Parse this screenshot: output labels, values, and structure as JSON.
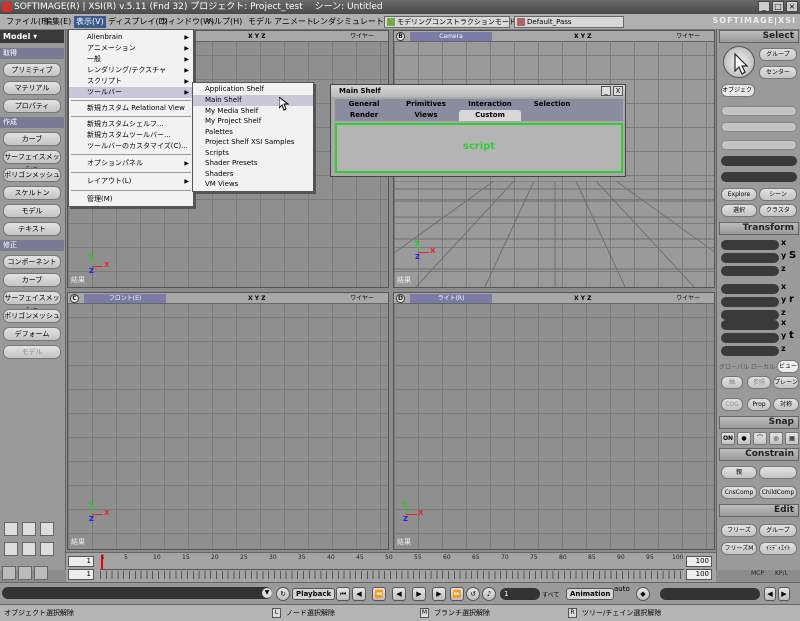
{
  "window": {
    "title": "SOFTIMAGE(R) | XSI(R) v.5.11 (Fnd 32) プロジェクト: Project_test　 シーン: Untitled",
    "brand": "SOFTIMAGE|XSI"
  },
  "menubar": {
    "items": [
      "ファイル(F)",
      "編集(E)",
      "表示(V)",
      "ディスプレイ(D)",
      "ウィンドウ(W)",
      "ヘルプ(H)",
      "モデル",
      "アニメート",
      "レンダ",
      "シミュレート"
    ],
    "mode_combo": "モデリングコンストラクションモード",
    "pass_combo": "Default_Pass"
  },
  "left_toolbar": {
    "model_label": "Model",
    "sections": [
      {
        "header": "取得",
        "buttons": [
          "プリミティブ",
          "マテリアル",
          "プロパティ"
        ]
      },
      {
        "header": "作成",
        "buttons": [
          "カーブ",
          "サーフェイスメッシュ",
          "ポリゴンメッシュ",
          "スケルトン",
          "モデル",
          "テキスト"
        ]
      },
      {
        "header": "修正",
        "buttons": [
          "コンポーネント",
          "カーブ",
          "サーフェイスメッシュ",
          "ポリゴンメッシュ",
          "デフォーム",
          "モデル"
        ]
      }
    ]
  },
  "view_menu": {
    "items": [
      {
        "label": "Alienbrain",
        "arrow": true
      },
      {
        "label": "アニメーション",
        "arrow": true
      },
      {
        "label": "一般",
        "arrow": true
      },
      {
        "label": "レンダリング/テクスチャ",
        "arrow": true
      },
      {
        "label": "スクリプト",
        "arrow": true
      },
      {
        "label": "ツールバー",
        "arrow": true
      },
      {
        "label": "新規カスタム Relational View",
        "arrow": false
      },
      {
        "label": "新規カスタムシェルフ...",
        "arrow": false
      },
      {
        "label": "新規カスタムツールバー...",
        "arrow": false
      },
      {
        "label": "ツールバーのカスタマイズ(C)...",
        "arrow": false
      },
      {
        "label": "オプションパネル",
        "arrow": true
      },
      {
        "label": "レイアウト(L)",
        "arrow": true
      },
      {
        "label": "管理(M)",
        "arrow": false
      }
    ]
  },
  "toolbar_submenu": {
    "items": [
      "Application Shelf",
      "Main Shelf",
      "My Media Shelf",
      "My Project Shelf",
      "Palettes",
      "Project Shelf XSI Samples",
      "Scripts",
      "Shader Presets",
      "Shaders",
      "VM Views"
    ]
  },
  "main_shelf": {
    "title": "Main Shelf",
    "tabs_row1": [
      "General",
      "Primitives",
      "Interaction",
      "Selection"
    ],
    "tabs_row2": [
      "Render",
      "Views",
      "Custom"
    ],
    "active_tab": "Custom",
    "content_text": "script",
    "min_btn": "_",
    "close_btn": "X"
  },
  "viewports": [
    {
      "letter": "A",
      "camera": "",
      "xyz": "X Y Z",
      "wire": "ワイヤー",
      "status": "結果"
    },
    {
      "letter": "B",
      "camera": "Camera",
      "xyz": "X Y Z",
      "wire": "ワイヤー",
      "status": "結果"
    },
    {
      "letter": "C",
      "camera": "フロント(E)",
      "xyz": "X Y Z",
      "wire": "ワイヤー",
      "status": "結果"
    },
    {
      "letter": "D",
      "camera": "ライト(R)",
      "xyz": "X Y Z",
      "wire": "ワイヤー",
      "status": "結果"
    }
  ],
  "axis": {
    "x": "X",
    "y": "Y",
    "z": "Z"
  },
  "right_panel": {
    "select_header": "Select",
    "group_btn": "グループ",
    "center_btn": "センター",
    "object_btn": "オブジェクト",
    "explore_btn": "Explore",
    "scene_btn": "シーン",
    "select_btn": "選択",
    "class_btn": "クラスタ",
    "transform_header": "Transform",
    "s": "S",
    "r": "r",
    "t": "t",
    "x": "x",
    "y": "y",
    "z": "z",
    "global": "グローバル",
    "local": "ローカル",
    "view": "ビュー",
    "axis_btn": "軸",
    "ref_btn": "参照",
    "plane_btn": "プレーン",
    "cog_btn": "COG",
    "prop_btn": "Prop",
    "sym_btn": "対称",
    "snap_header": "Snap",
    "on_btn": "ON",
    "constrain_header": "Constrain",
    "parent_btn": "親",
    "cnscomp_btn": "CnsComp",
    "childcomp_btn": "ChildComp",
    "edit_header": "Edit",
    "freeze_btn": "フリーズ",
    "group2_btn": "グループ",
    "freezem_btn": "フリーズM",
    "immed_btn": "ｲﾐﾃﾞｨｴｲﾄ",
    "mcp": "MCP",
    "kpl": "KP/L"
  },
  "timeline": {
    "start": "1",
    "current": "1",
    "end": "100",
    "end2": "100",
    "ticks": [
      "1",
      "5",
      "10",
      "15",
      "20",
      "25",
      "30",
      "35",
      "40",
      "45",
      "50",
      "55",
      "60",
      "65",
      "70",
      "75",
      "80",
      "85",
      "90",
      "95",
      "100"
    ]
  },
  "playbar": {
    "playback_label": "Playback",
    "frame_value": "1",
    "all_label": "すべて",
    "animation_label": "Animation",
    "auto_label": "auto"
  },
  "statusbar": {
    "left_text": "オブジェクト選択解除",
    "l_key": "L",
    "l_text": "ノード選択解除",
    "m_key": "M",
    "m_text": "ブランチ選択解除",
    "r_key": "R",
    "r_text": "ツリー/チェイン選択解除"
  },
  "colors": {
    "script_green": "#33cc33",
    "menu_highlight": "#3a5a8a"
  }
}
